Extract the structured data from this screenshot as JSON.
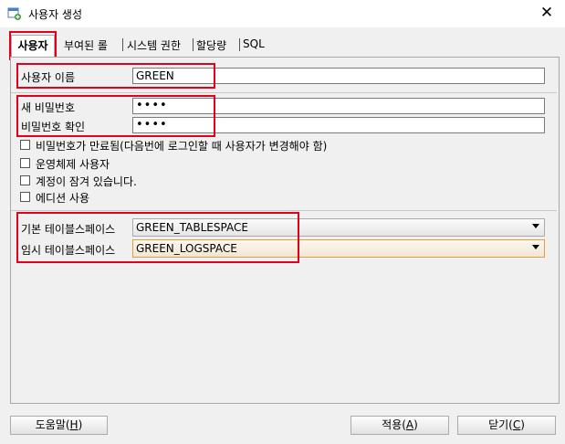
{
  "window": {
    "title": "사용자 생성",
    "close_glyph": "✕"
  },
  "tabs": [
    {
      "label": "사용자",
      "active": true
    },
    {
      "label": "부여된 롤"
    },
    {
      "label": "시스템 권한"
    },
    {
      "label": "할당량"
    },
    {
      "label": "SQL"
    }
  ],
  "user": {
    "name_label": "사용자 이름",
    "name_value": "GREEN"
  },
  "password": {
    "new_label": "새 비밀번호",
    "new_value": "••••",
    "confirm_label": "비밀번호 확인",
    "confirm_value": "••••"
  },
  "options": [
    {
      "label": "비밀번호가 만료됨(다음번에 로그인할 때 사용자가 변경해야 함)",
      "checked": false
    },
    {
      "label": "운영체제 사용자",
      "checked": false
    },
    {
      "label": "계정이 잠겨 있습니다.",
      "checked": false
    },
    {
      "label": "에디션 사용",
      "checked": false
    }
  ],
  "tablespace": {
    "default_label": "기본 테이블스페이스",
    "default_value": "GREEN_TABLESPACE",
    "temp_label": "임시 테이블스페이스",
    "temp_value": "GREEN_LOGSPACE"
  },
  "buttons": {
    "help": {
      "text": "도움말(",
      "mnemonic": "H",
      "suffix": ")"
    },
    "apply": {
      "text": "적용(",
      "mnemonic": "A",
      "suffix": ")"
    },
    "close": {
      "text": "닫기(",
      "mnemonic": "C",
      "suffix": ")"
    }
  },
  "colors": {
    "highlight": "#e3001b",
    "focus_border": "#e0a040"
  },
  "icons": {
    "app": "oracle-sql-developer-icon",
    "close": "close-icon",
    "dropdown": "chevron-down-icon"
  }
}
